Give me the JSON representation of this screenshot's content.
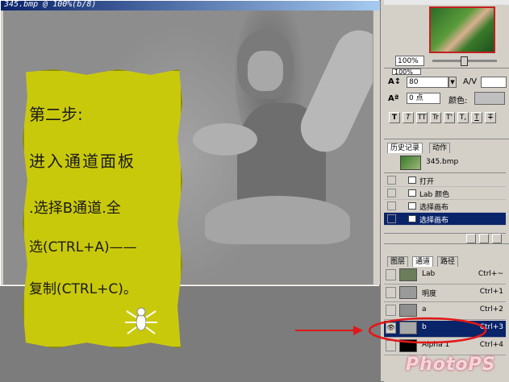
{
  "document": {
    "title": "345.bmp @ 100%(b/8)"
  },
  "note": {
    "step": "第二步:",
    "line1": "进入通道面板",
    "line2": ".选择B通道.全",
    "line3": "选(CTRL+A)——",
    "line4": "复制(CTRL+C)。"
  },
  "navigator": {
    "zoom": "100%"
  },
  "character": {
    "size": "80",
    "tracking": "0 点",
    "color_label": "颜色:",
    "zoom2": "100%",
    "type_buttons": [
      "T",
      "T",
      "TT",
      "Tr",
      "T'",
      "T,",
      "T",
      "T"
    ]
  },
  "history": {
    "tabs": [
      "历史记录",
      "动作"
    ],
    "snapshot": "345.bmp",
    "items": [
      {
        "label": "打开",
        "selected": false
      },
      {
        "label": "Lab 颜色",
        "selected": false
      },
      {
        "label": "选择画布",
        "selected": false
      },
      {
        "label": "选择画布",
        "selected": true
      }
    ]
  },
  "channels": {
    "tabs": [
      "图层",
      "通道",
      "路径"
    ],
    "rows": [
      {
        "name": "Lab",
        "shortcut": "Ctrl+~",
        "eye": false,
        "selected": false,
        "thumb": "#6b7d5a"
      },
      {
        "name": "明度",
        "shortcut": "Ctrl+1",
        "eye": false,
        "selected": false,
        "thumb": "#9a9a9a"
      },
      {
        "name": "a",
        "shortcut": "Ctrl+2",
        "eye": false,
        "selected": false,
        "thumb": "#8f8f8f"
      },
      {
        "name": "b",
        "shortcut": "Ctrl+3",
        "eye": true,
        "selected": true,
        "thumb": "#a8a8a8"
      },
      {
        "name": "Alpha 1",
        "shortcut": "Ctrl+4",
        "eye": false,
        "selected": false,
        "thumb": "#000000"
      }
    ]
  },
  "watermark": "PhotoPS",
  "colors": {
    "note_yellow": "#c9c90c",
    "selection_blue": "#0a246a",
    "annotation_red": "#e01818"
  }
}
